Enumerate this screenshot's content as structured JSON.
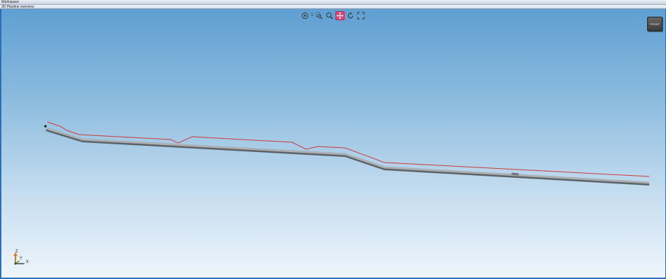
{
  "window": {
    "workspace_title": "Workspace",
    "panel_title": "3D Pipeline overview"
  },
  "toolbar": {
    "items": [
      {
        "icon": "pipe-info-icon"
      },
      {
        "separator": "1"
      },
      {
        "icon": "zoom-window-icon"
      },
      {
        "icon": "zoom-icon"
      },
      {
        "icon": "pan-icon",
        "active": true
      },
      {
        "icon": "rotate-icon"
      },
      {
        "icon": "fit-all-icon"
      }
    ]
  },
  "view_cube": {
    "label": "FRONT"
  },
  "axes": {
    "z_label": "Z",
    "y_label": "Y",
    "x_label": "X"
  },
  "colors": {
    "terrain_line": "#cc3a3a",
    "pipe": "#8f9599",
    "active_tool": "#d9487c",
    "sky_top": "#5f9fd2",
    "sky_bottom": "#eef5fb"
  }
}
